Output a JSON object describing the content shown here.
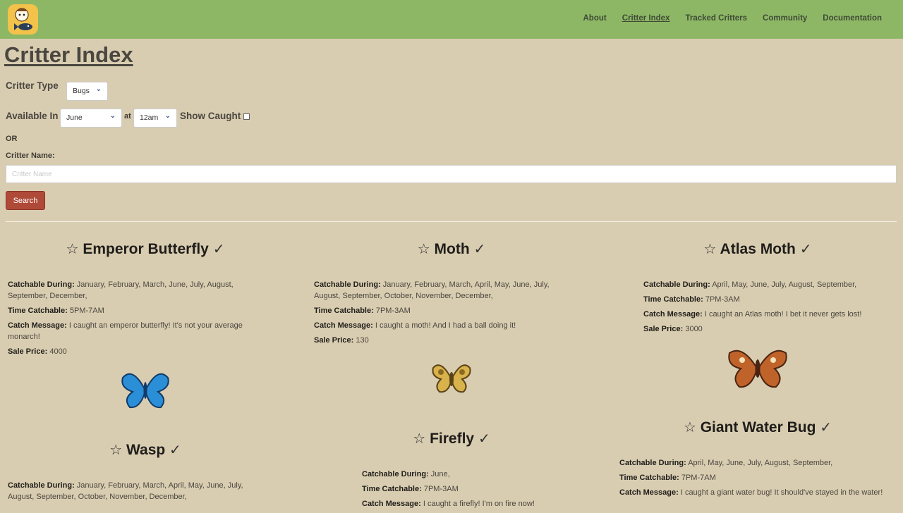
{
  "nav": {
    "items": [
      "About",
      "Critter Index",
      "Tracked Critters",
      "Community",
      "Documentation"
    ],
    "active_index": 1
  },
  "page_title": "Critter Index",
  "filters": {
    "critter_type_label": "Critter Type",
    "critter_type_value": "Bugs",
    "available_in_label": "Available In",
    "month_value": "June",
    "at_label": "at",
    "time_value": "12am",
    "show_caught_label": "Show Caught",
    "or_label": "OR",
    "critter_name_label": "Critter Name:",
    "critter_name_placeholder": "Critter Name",
    "search_label": "Search"
  },
  "field_labels": {
    "catchable": "Catchable During:",
    "time": "Time Catchable:",
    "message": "Catch Message:",
    "price": "Sale Price:"
  },
  "icons": {
    "favorite": "star-outline-icon",
    "caught": "checkmark-icon"
  },
  "colors": {
    "header": "#8db765",
    "background": "#d9cdb1",
    "search_button": "#b04a38"
  },
  "critters": [
    {
      "name": "Emperor Butterfly",
      "catchable": "January, February, March, June, July, August, September, December,",
      "time": "5PM-7AM",
      "message": "I caught an emperor butterfly! It's not your average monarch!",
      "price": "4000"
    },
    {
      "name": "Moth",
      "catchable": "January, February, March, April, May, June, July, August, September, October, November, December,",
      "time": "7PM-3AM",
      "message": "I caught a moth! And I had a ball doing it!",
      "price": "130"
    },
    {
      "name": "Atlas Moth",
      "catchable": "April, May, June, July, August, September,",
      "time": "7PM-3AM",
      "message": "I caught an Atlas moth! I bet it never gets lost!",
      "price": "3000"
    },
    {
      "name": "Wasp",
      "catchable": "January, February, March, April, May, June, July, August, September, October, November, December,"
    },
    {
      "name": "Firefly",
      "catchable": "June,",
      "time": "7PM-3AM",
      "message": "I caught a firefly! I'm on fire now!"
    },
    {
      "name": "Giant Water Bug",
      "catchable": "April, May, June, July, August, September,",
      "time": "7PM-7AM",
      "message": "I caught a giant water bug! It should've stayed in the water!"
    }
  ]
}
